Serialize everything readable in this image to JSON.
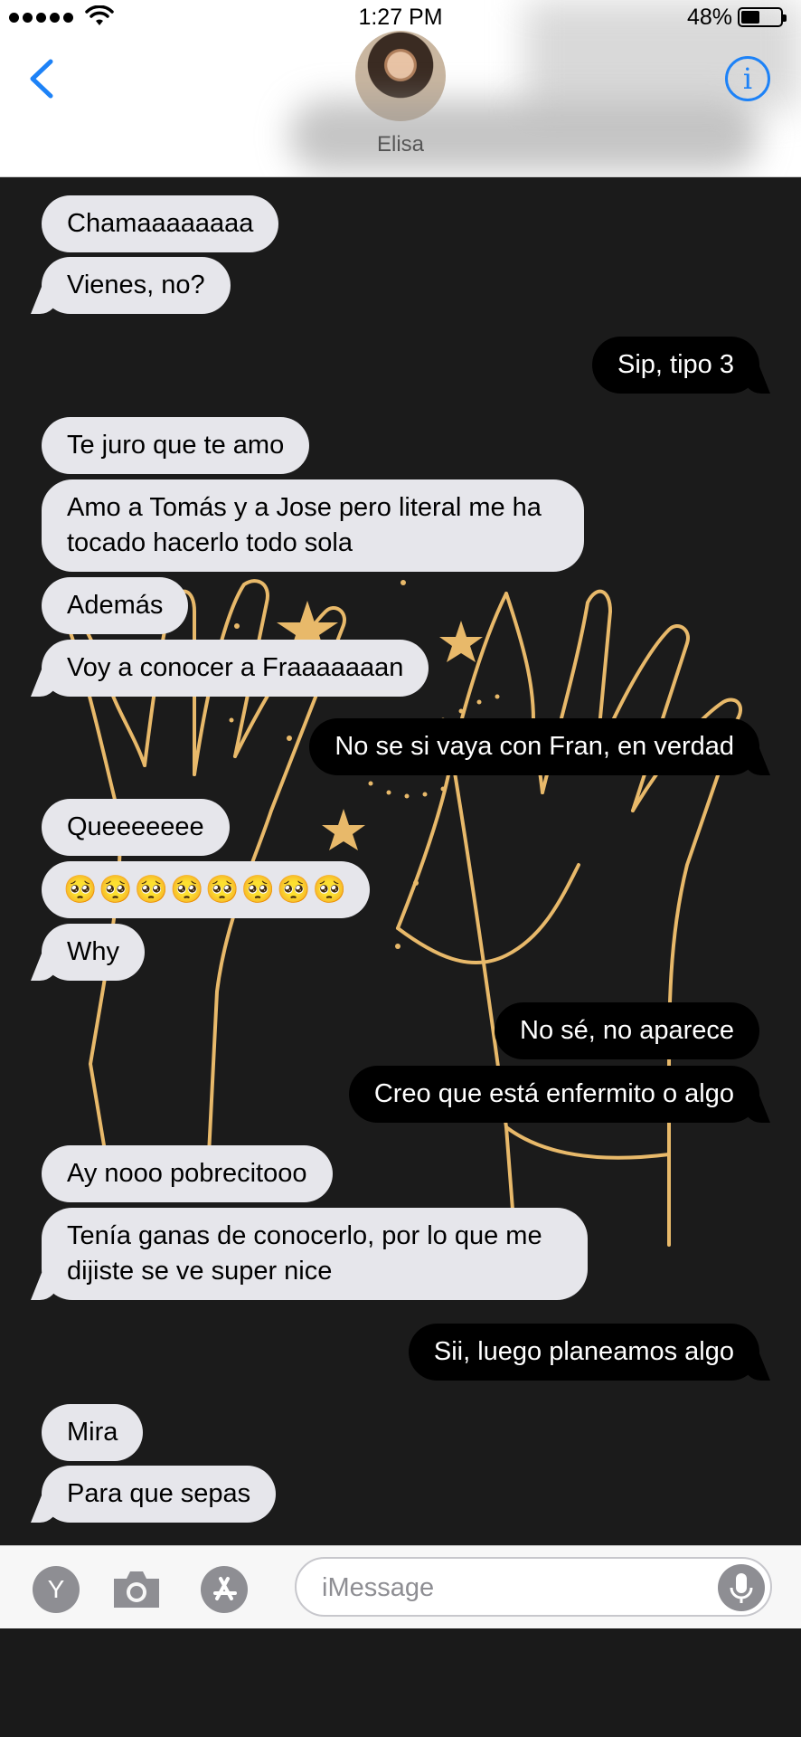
{
  "status_bar": {
    "time": "1:27 PM",
    "battery": "48%"
  },
  "header": {
    "contact_name": "Elisa",
    "info_glyph": "i"
  },
  "messages": [
    {
      "text": "Chamaaaaaaaa",
      "side": "in"
    },
    {
      "text": "Vienes, no?",
      "side": "in"
    },
    {
      "text": "Sip, tipo 3",
      "side": "out"
    },
    {
      "text": "Te juro que te amo",
      "side": "in"
    },
    {
      "text": "Amo a Tomás y a Jose pero literal me ha tocado hacerlo todo sola",
      "side": "in"
    },
    {
      "text": "Además",
      "side": "in"
    },
    {
      "text": "Voy a conocer a Fraaaaaaan",
      "side": "in"
    },
    {
      "text": "No se si vaya con Fran, en verdad",
      "side": "out"
    },
    {
      "text": "Queeeeeee",
      "side": "in"
    },
    {
      "text": "🥺🥺🥺🥺🥺🥺🥺🥺",
      "side": "in"
    },
    {
      "text": "Why",
      "side": "in"
    },
    {
      "text": "No sé, no aparece",
      "side": "out"
    },
    {
      "text": "Creo que está enfermito o algo",
      "side": "out"
    },
    {
      "text": "Ay nooo pobrecitooo",
      "side": "in"
    },
    {
      "text": "Tenía ganas de conocerlo, por lo que me dijiste se ve super nice",
      "side": "in"
    },
    {
      "text": "Sii, luego planeamos algo",
      "side": "out"
    },
    {
      "text": "Mira",
      "side": "in"
    },
    {
      "text": "Para que sepas",
      "side": "in"
    }
  ],
  "input_bar": {
    "placeholder": "iMessage",
    "app_letter": "Y"
  },
  "colors": {
    "accent": "#1d82f7",
    "bubble_in": "#e6e6eb",
    "bubble_out": "#000000",
    "wallpaper_line": "#e8b96a"
  }
}
